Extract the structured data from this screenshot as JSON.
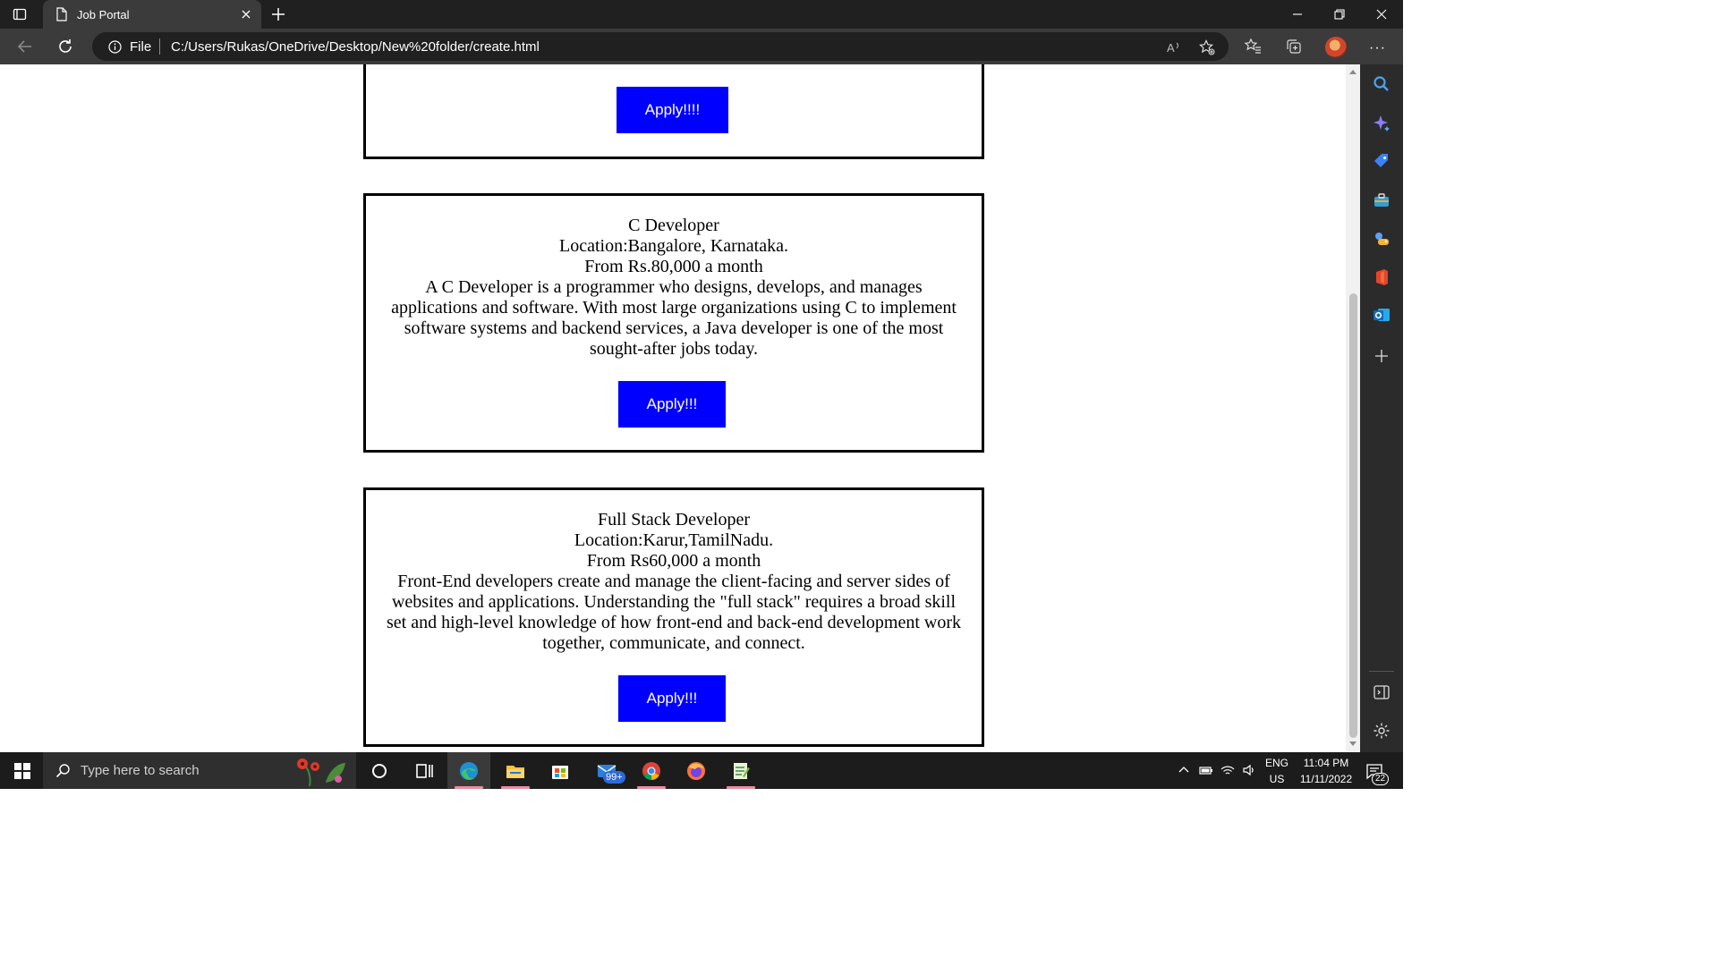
{
  "browser": {
    "tab_title": "Job Portal",
    "scheme_label": "File",
    "url": "C:/Users/Rukas/OneDrive/Desktop/New%20folder/create.html"
  },
  "jobs": [
    {
      "apply_label": "Apply!!!!"
    },
    {
      "title": "C Developer",
      "location": "Location:Bangalore, Karnataka.",
      "salary": "From Rs.80,000 a month",
      "description": "A C Developer is a programmer who designs, develops, and manages applications and software. With most large organizations using C to implement software systems and backend services, a Java developer is one of the most sought-after jobs today.",
      "apply_label": "Apply!!!"
    },
    {
      "title": "Full Stack Developer",
      "location": "Location:Karur,TamilNadu.",
      "salary": "From Rs60,000 a month",
      "description": "Front-End developers create and manage the client-facing and server sides of websites and applications. Understanding the \"full stack\" requires a broad skill set and high-level knowledge of how front-end and back-end development work together, communicate, and connect.",
      "apply_label": "Apply!!!"
    }
  ],
  "taskbar": {
    "search_placeholder": "Type here to search",
    "mail_badge": "99+",
    "language": "ENG",
    "region": "US",
    "time": "11:04 PM",
    "date": "11/11/2022",
    "notification_count": "22"
  },
  "colors": {
    "apply_button": "#0000ff",
    "browser_chrome": "#202020",
    "toolbar": "#3b3b3b"
  }
}
